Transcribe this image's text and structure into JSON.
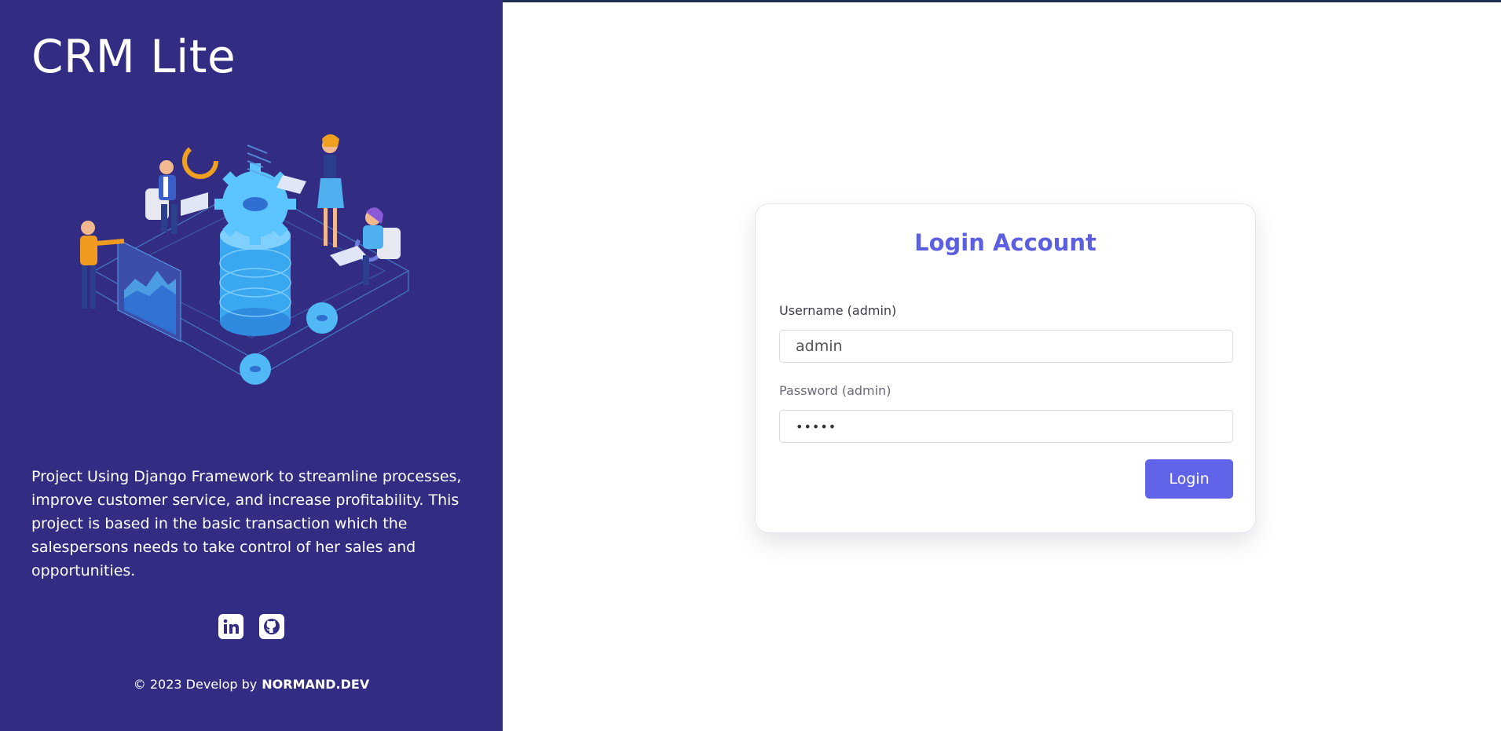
{
  "sidebar": {
    "app_title": "CRM Lite",
    "description": "Project Using Django Framework to streamline processes, improve customer service, and increase profitability. This project is based in the basic transaction which the salespersons needs to take control of her sales and opportunities.",
    "social": {
      "linkedin_icon": "linkedin-icon",
      "github_icon": "github-icon"
    },
    "footer": {
      "copyright": "© 2023 Develop by",
      "brand": "NORMAND.DEV"
    },
    "background_color": "#322d82"
  },
  "login": {
    "title": "Login Account",
    "username_label": "Username (admin)",
    "username_value": "admin",
    "password_label": "Password (admin)",
    "password_value": "admin",
    "submit_label": "Login",
    "accent_color": "#6163e8"
  }
}
